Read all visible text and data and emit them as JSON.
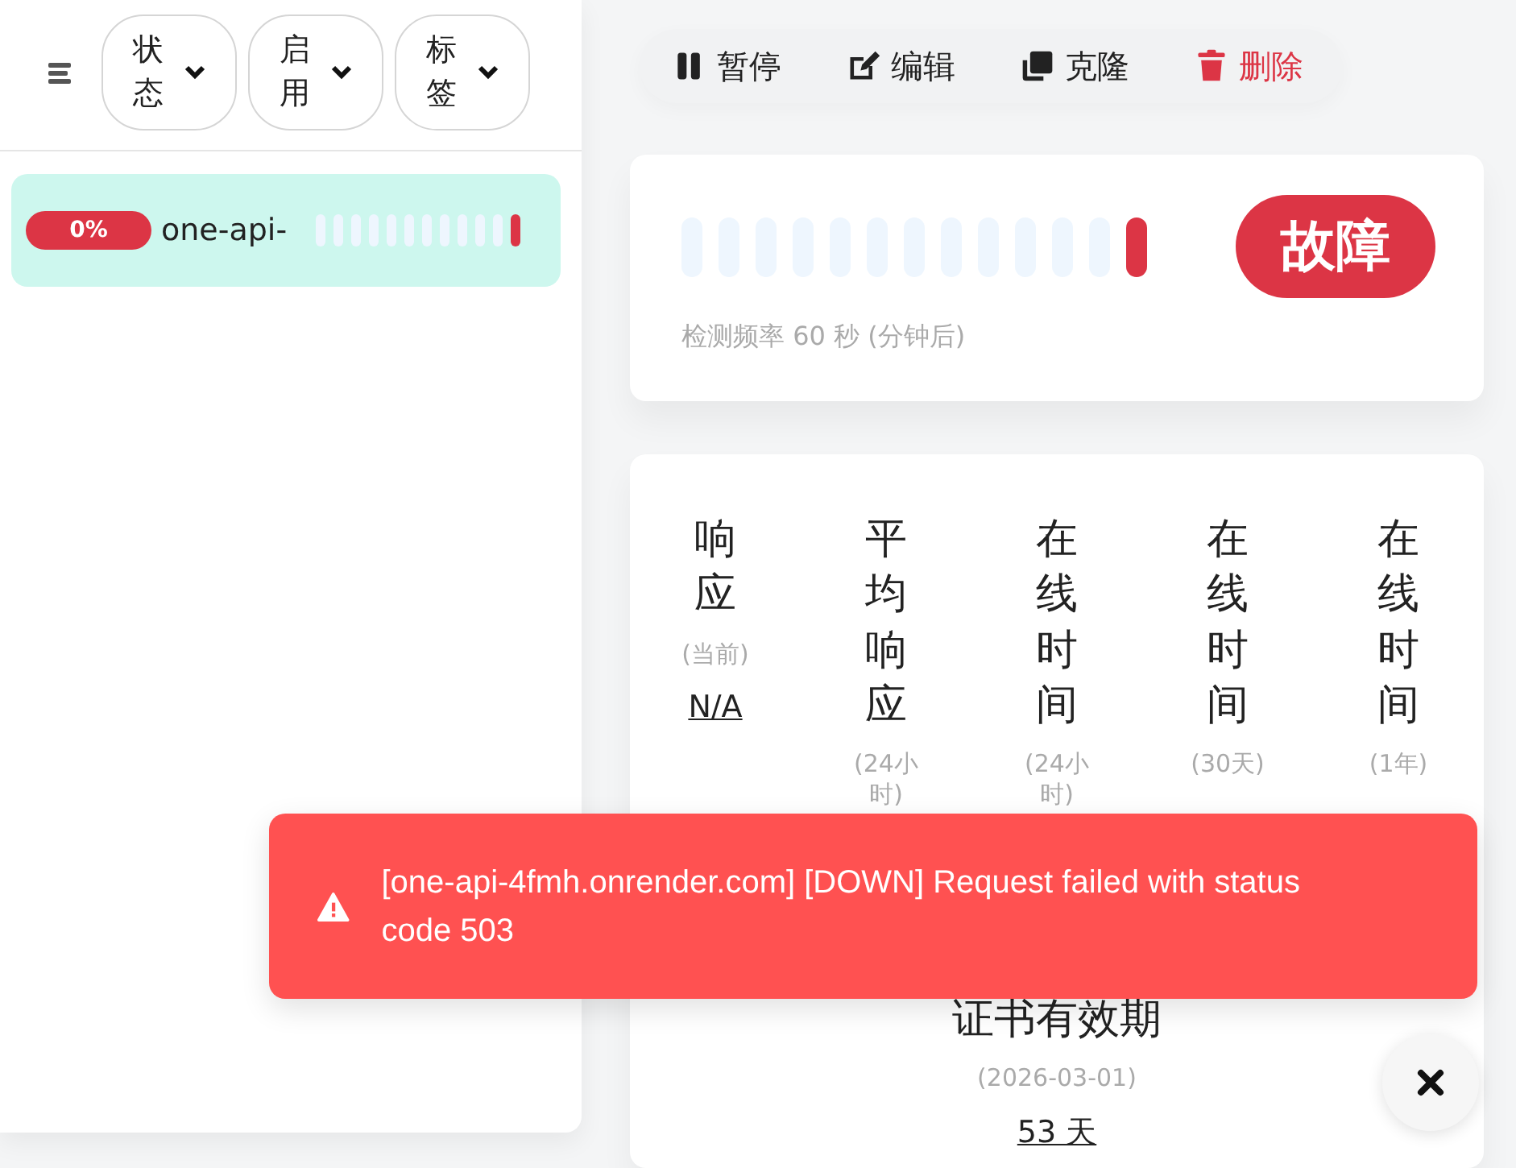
{
  "sidebar": {
    "filters": [
      {
        "label": "状态"
      },
      {
        "label": "启用"
      },
      {
        "label": "标签"
      }
    ],
    "monitors": [
      {
        "name": "one-api-",
        "uptime": "0%",
        "selected": true,
        "beats": [
          {
            "color": "#eef6fe"
          },
          {
            "color": "#eef6fe"
          },
          {
            "color": "#eef6fe"
          },
          {
            "color": "#eef6fe"
          },
          {
            "color": "#eef6fe"
          },
          {
            "color": "#eef6fe"
          },
          {
            "color": "#eef6fe"
          },
          {
            "color": "#eef6fe"
          },
          {
            "color": "#eef6fe"
          },
          {
            "color": "#eef6fe"
          },
          {
            "color": "#eef6fe"
          },
          {
            "color": "#dc3545"
          }
        ]
      }
    ]
  },
  "toolbar": {
    "buttons": [
      {
        "kind": "pause",
        "label": "暂停"
      },
      {
        "kind": "edit",
        "label": "编辑"
      },
      {
        "kind": "clone",
        "label": "克隆"
      },
      {
        "kind": "delete",
        "label": "删除"
      }
    ]
  },
  "status_card": {
    "beats": [
      {
        "color": "#eef6fe"
      },
      {
        "color": "#eef6fe"
      },
      {
        "color": "#eef6fe"
      },
      {
        "color": "#eef6fe"
      },
      {
        "color": "#eef6fe"
      },
      {
        "color": "#eef6fe"
      },
      {
        "color": "#eef6fe"
      },
      {
        "color": "#eef6fe"
      },
      {
        "color": "#eef6fe"
      },
      {
        "color": "#eef6fe"
      },
      {
        "color": "#eef6fe"
      },
      {
        "color": "#eef6fe"
      },
      {
        "color": "#dc3545"
      }
    ],
    "status": "故障",
    "interval_text": "检测频率 60 秒 (分钟后)"
  },
  "stats": [
    {
      "title": "响应",
      "subtitle": "(当前)",
      "value": "N/A"
    },
    {
      "title": "平均响应",
      "subtitle": "(24小时)"
    },
    {
      "title": "在线时间",
      "subtitle": "(24小时)"
    },
    {
      "title": "在线时间",
      "subtitle": "(30天)"
    },
    {
      "title": "在线时间",
      "subtitle": "(1年)"
    }
  ],
  "certificate": {
    "title": "证书有效期",
    "subtitle": "(2026-03-01)",
    "value": "53 天"
  },
  "toast": {
    "kind": "error",
    "message": "[one-api-4fmh.onrender.com] [DOWN] Request failed with status code 503"
  }
}
